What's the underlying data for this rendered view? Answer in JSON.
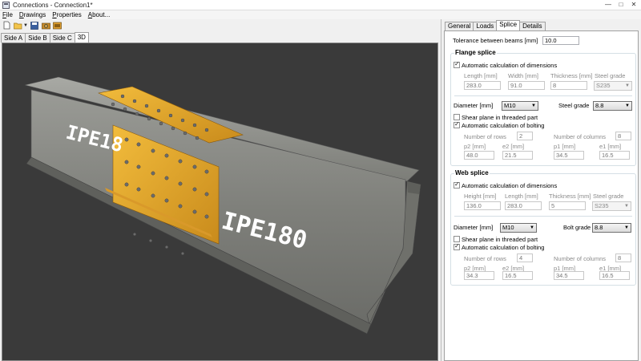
{
  "window": {
    "title": "Connections - Connection1*",
    "min": "—",
    "max": "□",
    "close": "✕"
  },
  "menu": [
    "File",
    "Drawings",
    "Properties",
    "About..."
  ],
  "view_tabs": [
    "Side A",
    "Side B",
    "Side C",
    "3D"
  ],
  "panel_tabs": [
    "General",
    "Loads",
    "Splice",
    "Details"
  ],
  "splice": {
    "tolerance_label": "Tolerance between beams [mm]",
    "tolerance_value": "10.0",
    "flange": {
      "title": "Flange splice",
      "auto_dims_label": "Automatic calculation of dimensions",
      "length_label": "Length [mm]",
      "width_label": "Width [mm]",
      "thickness_label": "Thickness [mm]",
      "steel_grade_label": "Steel grade",
      "length_value": "283.0",
      "width_value": "91.0",
      "thickness_value": "8",
      "steel_grade_value": "S235",
      "diameter_label": "Diameter [mm]",
      "diameter_value": "M10",
      "bolt_steel_grade_label": "Steel grade",
      "bolt_steel_grade_value": "8.8",
      "shear_label": "Shear plane in threaded part",
      "auto_bolt_label": "Automatic calculation of bolting",
      "rows_label": "Number of rows",
      "rows_value": "2",
      "cols_label": "Number of columns",
      "cols_value": "8",
      "p2_label": "p2 [mm]",
      "e2_label": "e2 [mm]",
      "p1_label": "p1 [mm]",
      "e1_label": "e1 [mm]",
      "p2_value": "48.0",
      "e2_value": "21.5",
      "p1_value": "34.5",
      "e1_value": "16.5"
    },
    "web": {
      "title": "Web splice",
      "auto_dims_label": "Automatic calculation of dimensions",
      "height_label": "Height [mm]",
      "length_label": "Length [mm]",
      "thickness_label": "Thickness [mm]",
      "steel_grade_label": "Steel grade",
      "height_value": "136.0",
      "length_value": "283.0",
      "thickness_value": "5",
      "steel_grade_value": "S235",
      "diameter_label": "Diameter [mm]",
      "diameter_value": "M10",
      "bolt_grade_label": "Bolt grade",
      "bolt_grade_value": "8.8",
      "shear_label": "Shear plane in threaded part",
      "auto_bolt_label": "Automatic calculation of bolting",
      "rows_label": "Number of rows",
      "rows_value": "4",
      "cols_label": "Number of columns",
      "cols_value": "8",
      "p2_label": "p2 [mm]",
      "e2_label": "e2 [mm]",
      "p1_label": "p1 [mm]",
      "e1_label": "e1 [mm]",
      "p2_value": "34.3",
      "e2_value": "16.5",
      "p1_value": "34.5",
      "e1_value": "16.5"
    }
  },
  "model": {
    "beam_label_left": "IPE18",
    "beam_label_right": "IPE180",
    "colors": {
      "background": "#3a3a3a",
      "steel": "#8a8b86",
      "plate": "#e0a52a"
    }
  }
}
